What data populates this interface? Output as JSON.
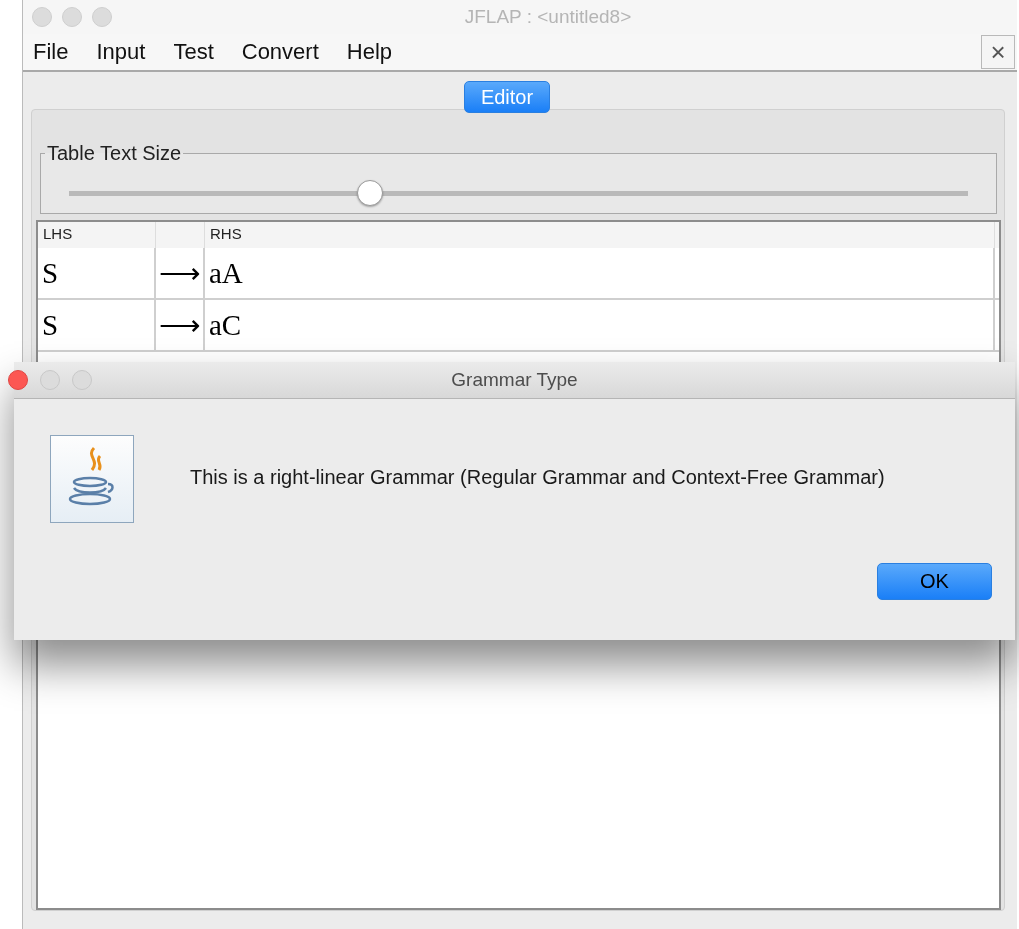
{
  "window": {
    "title": "JFLAP : <untitled8>",
    "close": "×"
  },
  "menu": [
    {
      "label": "File"
    },
    {
      "label": "Input"
    },
    {
      "label": "Test"
    },
    {
      "label": "Convert"
    },
    {
      "label": "Help"
    }
  ],
  "mode_button": {
    "label": "Editor",
    "selected": true
  },
  "text_size": {
    "title": "Table Text Size",
    "level": 0.33
  },
  "table": {
    "columns": [
      "LHS",
      "",
      "RHS"
    ],
    "rows": [
      {
        "lhs": "S",
        "arrow": "⟶",
        "rhs": "aA"
      },
      {
        "lhs": "S",
        "arrow": "⟶",
        "rhs": "aC"
      }
    ]
  },
  "dialog": {
    "title": "Grammar Type",
    "message": "This is a right-linear Grammar (Regular Grammar and Context-Free Grammar)",
    "button": "OK",
    "close_active": true
  }
}
